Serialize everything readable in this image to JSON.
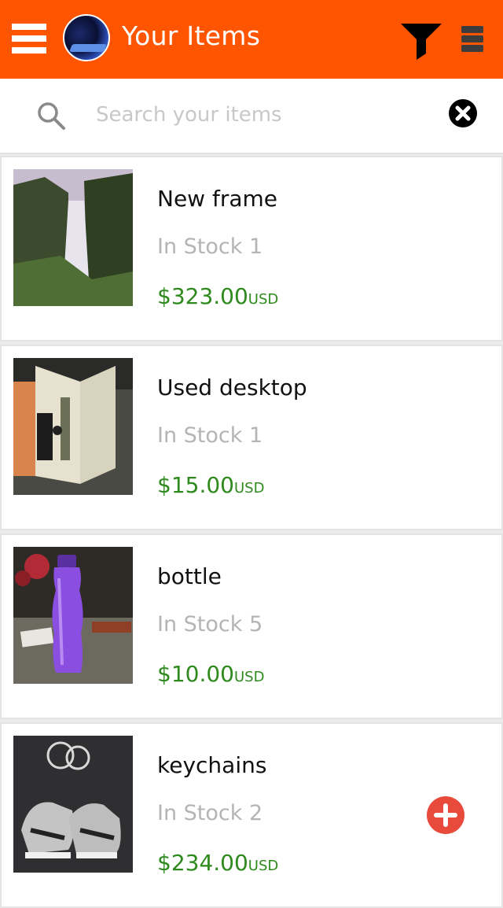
{
  "header": {
    "title": "Your Items",
    "menu_icon": "hamburger-icon",
    "filter_icon": "filter-icon",
    "more_icon": "more-icon",
    "accent_color": "#ff5400"
  },
  "search": {
    "placeholder": "Search your items",
    "value": ""
  },
  "items": [
    {
      "name": "New frame",
      "stock": "In Stock 1",
      "price": "$323.00",
      "currency": "USD",
      "image": "waterfall-photo"
    },
    {
      "name": "Used desktop",
      "stock": "In Stock 1",
      "price": "$15.00",
      "currency": "USD",
      "image": "desktop-photo"
    },
    {
      "name": "bottle",
      "stock": "In Stock 5",
      "price": "$10.00",
      "currency": "USD",
      "image": "bottle-photo"
    },
    {
      "name": "keychains",
      "stock": "In Stock 2",
      "price": "$234.00",
      "currency": "USD",
      "image": "keychain-photo"
    }
  ],
  "colors": {
    "price": "#2f8a1e",
    "stock": "#b4b4b4",
    "add_button": "#e84b3c"
  }
}
